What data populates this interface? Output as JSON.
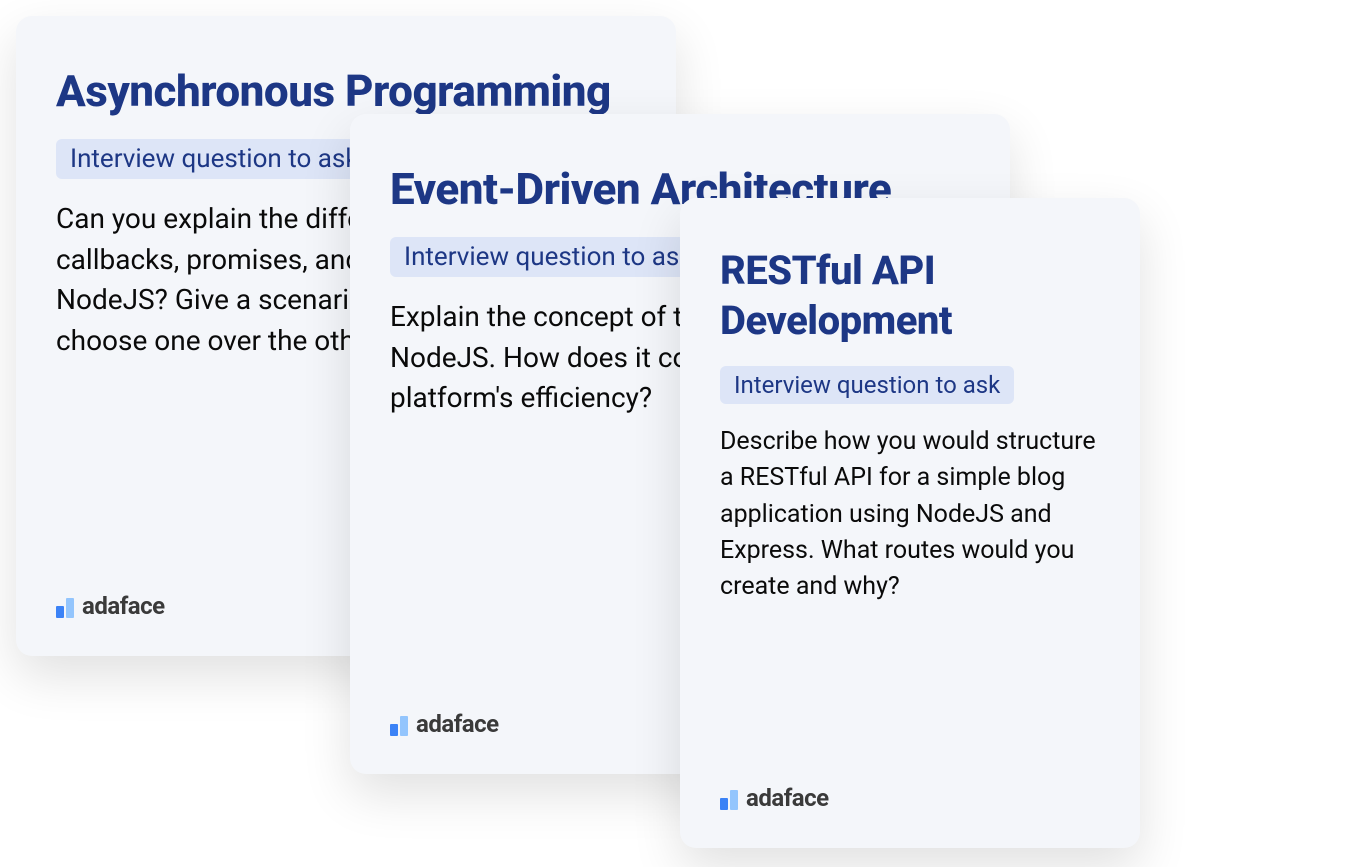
{
  "cards": [
    {
      "title": "Asynchronous Programming",
      "tag": "Interview question to ask",
      "body": "Can you explain the difference between callbacks, promises, and async/await in NodeJS? Give a scenario where you would choose one over the others.",
      "logo": "adaface"
    },
    {
      "title": "Event-Driven Architecture",
      "tag": "Interview question to ask",
      "body": "Explain the concept of the event loop in NodeJS. How does it contribute to the platform's efficiency?",
      "logo": "adaface"
    },
    {
      "title": "RESTful API Development",
      "tag": "Interview question to ask",
      "body": "Describe how you would structure a RESTful API for a simple blog application using NodeJS and Express. What routes would you create and why?",
      "logo": "adaface"
    }
  ]
}
